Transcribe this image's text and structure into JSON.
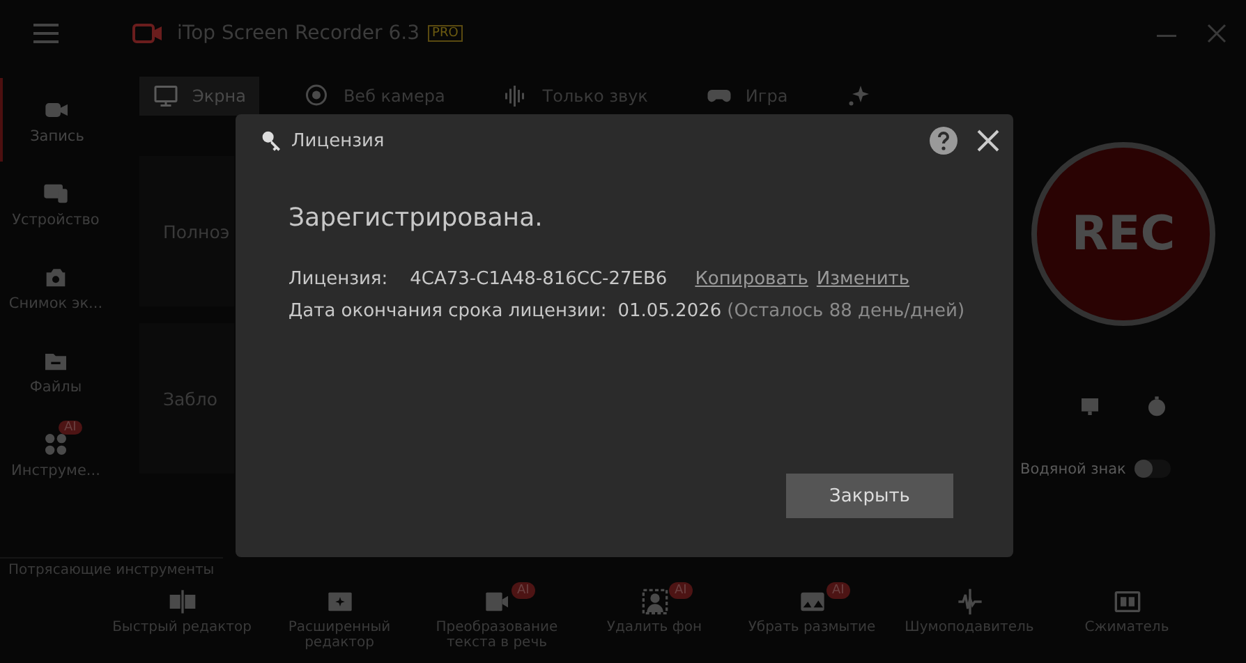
{
  "app": {
    "title": "iTop Screen Recorder 6.3",
    "badge": "PRO"
  },
  "sidebar": {
    "items": [
      {
        "label": "Запись",
        "selected": true
      },
      {
        "label": "Устройство",
        "selected": false
      },
      {
        "label": "Снимок эк...",
        "selected": false
      },
      {
        "label": "Файлы",
        "selected": false
      },
      {
        "label": "Инструме...",
        "selected": false,
        "badge": "AI"
      }
    ]
  },
  "modes": [
    {
      "label": "Экрна",
      "selected": true
    },
    {
      "label": "Веб камера",
      "selected": false
    },
    {
      "label": "Только звук",
      "selected": false
    },
    {
      "label": "Игра",
      "selected": false
    },
    {
      "selected": false
    }
  ],
  "capture_options": [
    "Полноэ",
    "Забло"
  ],
  "record": {
    "label": "REC",
    "watermark": {
      "label": "Водяной знак",
      "on": false
    }
  },
  "tools": {
    "title": "Потрясающие инструменты",
    "items": [
      {
        "label": "Быстрый редактор"
      },
      {
        "label": "Расширенный редактор"
      },
      {
        "label": "Преобразование текста в речь",
        "badge": "AI"
      },
      {
        "label": "Удалить фон",
        "badge": "AI"
      },
      {
        "label": "Убрать размытие",
        "badge": "AI"
      },
      {
        "label": "Шумоподавитель"
      },
      {
        "label": "Сжиматель"
      }
    ]
  },
  "dialog": {
    "title": "Лицензия",
    "status": "Зарегистрирована.",
    "license": {
      "label": "Лицензия:",
      "key": "4CA73-C1A48-816CC-27EB6",
      "links": [
        "Копировать",
        "Изменить"
      ]
    },
    "expiry": {
      "label": "Дата окончания срока лицензии:",
      "date": "01.05.2026",
      "remaining": "(Осталось 88 день/дней)"
    },
    "button": "Закрыть"
  }
}
